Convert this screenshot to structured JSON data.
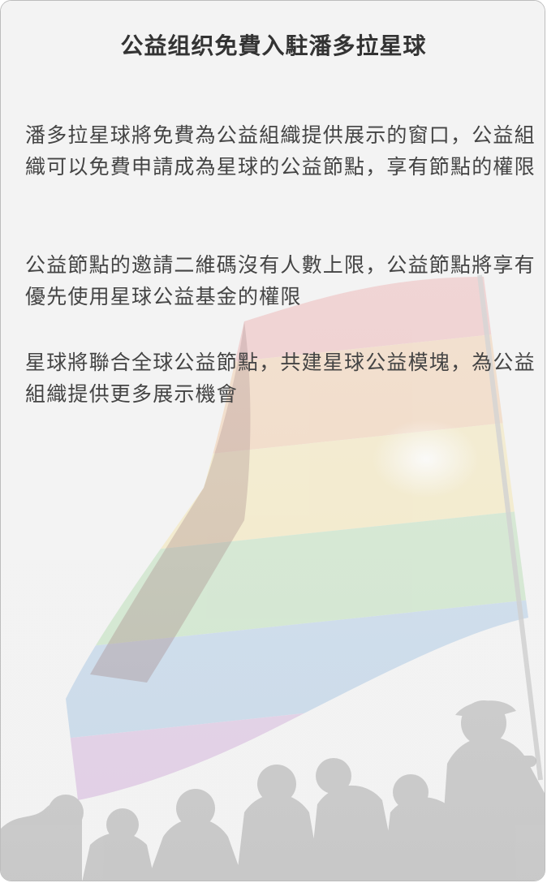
{
  "page": {
    "title": "公益组织免費入駐潘多拉星球",
    "paragraphs": [
      "潘多拉星球將免費為公益組織提供展示的窗口，公益組織可以免費申請成為星球的公益節點，享有節點的權限",
      "公益節點的邀請二維碼沒有人數上限，公益節點將享有優先使用星球公益基金的權限",
      "星球將聯合全球公益節點，共建星球公益模塊，為公益組織提供更多展示機會"
    ]
  },
  "background": {
    "image": "rainbow-flag-crowd-illustration",
    "flag_colors": [
      "#e88a8a",
      "#f0b27a",
      "#f3dc8a",
      "#9fd39a",
      "#8fb6dc",
      "#c79bd2"
    ]
  }
}
